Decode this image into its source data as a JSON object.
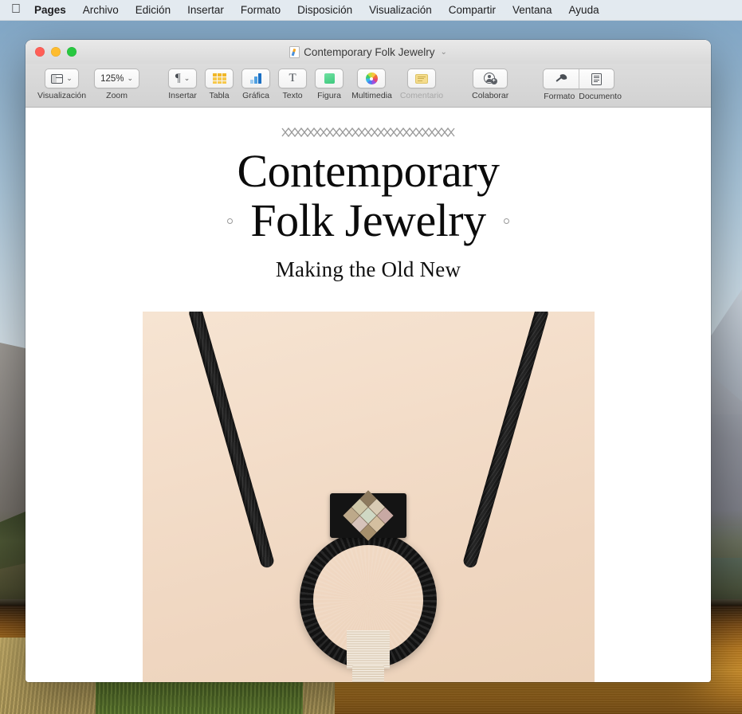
{
  "menubar": {
    "apple_icon": "apple-logo",
    "items": [
      {
        "label": "Pages",
        "bold": true
      },
      {
        "label": "Archivo"
      },
      {
        "label": "Edición"
      },
      {
        "label": "Insertar"
      },
      {
        "label": "Formato"
      },
      {
        "label": "Disposición"
      },
      {
        "label": "Visualización"
      },
      {
        "label": "Compartir"
      },
      {
        "label": "Ventana"
      },
      {
        "label": "Ayuda"
      }
    ]
  },
  "window": {
    "title": "Contemporary Folk Jewelry",
    "title_chevron": "⌄",
    "doc_icon": "pages-document-icon",
    "traffic_lights": {
      "close": "close-button",
      "minimize": "minimize-button",
      "zoom": "zoom-button"
    }
  },
  "toolbar": {
    "view": {
      "label": "Visualización",
      "icon": "view-layout-icon",
      "chevron": "⌄"
    },
    "zoom": {
      "label": "Zoom",
      "value": "125%",
      "chevron": "⌄"
    },
    "insert": {
      "label": "Insertar",
      "icon": "paragraph-pilcrow-icon",
      "chevron": "⌄"
    },
    "table": {
      "label": "Tabla",
      "icon": "table-icon"
    },
    "chart": {
      "label": "Gráfica",
      "icon": "bar-chart-icon"
    },
    "text": {
      "label": "Texto",
      "icon": "text-box-icon"
    },
    "shape": {
      "label": "Figura",
      "icon": "shape-square-icon"
    },
    "media": {
      "label": "Multimedia",
      "icon": "photos-pinwheel-icon"
    },
    "comment": {
      "label": "Comentario",
      "icon": "comment-note-icon",
      "disabled": true
    },
    "collaborate": {
      "label": "Colaborar",
      "icon": "add-person-icon"
    },
    "format": {
      "label": "Formato",
      "icon": "paintbrush-icon"
    },
    "document": {
      "label": "Documento",
      "icon": "document-lines-icon"
    }
  },
  "document": {
    "ornament": "diamond-chain-divider",
    "title_line1": "Contemporary",
    "title_line2": "Folk Jewelry",
    "subtitle": "Making the Old New",
    "image": {
      "name": "necklace-photo",
      "description": "Black braided cord necklace with quilted diamond pendant and white fiber wrapping",
      "background_color": "#f3ddc9",
      "cord_color": "#121212",
      "wrap_color": "#f4ece0",
      "quilt_colors": [
        "#8d7a5e",
        "#d9cbb4",
        "#c8a9a4",
        "#cfc7a8",
        "#cfd8c4",
        "#d4bfa0",
        "#bda98a",
        "#d6c3ba",
        "#a68f6c"
      ]
    }
  },
  "colors": {
    "accent_yellow": "#f7c84a",
    "accent_blue": "#1a6fc4",
    "accent_green": "#3ec97f",
    "toolbar_bg": "#d6d6d6",
    "menubar_bg": "#ecf0f3"
  }
}
